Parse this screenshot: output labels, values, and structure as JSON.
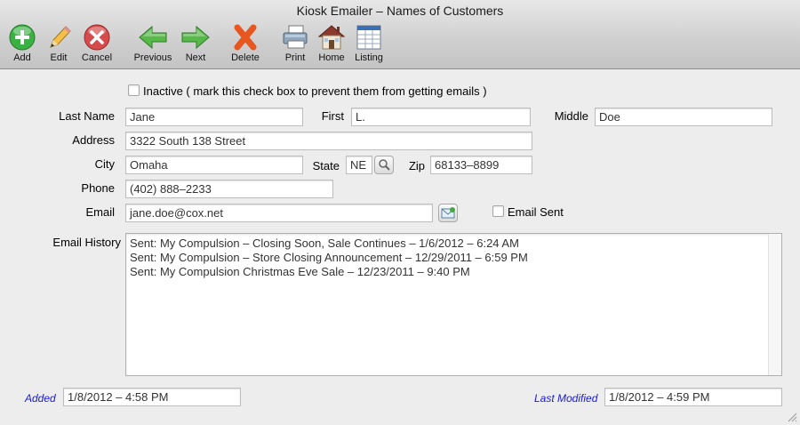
{
  "window": {
    "title": "Kiosk Emailer – Names of Customers"
  },
  "toolbar": {
    "add": "Add",
    "edit": "Edit",
    "cancel": "Cancel",
    "previous": "Previous",
    "next": "Next",
    "delete": "Delete",
    "print": "Print",
    "home": "Home",
    "listing": "Listing"
  },
  "colors": {
    "add_green": "#3bb143",
    "cancel_red": "#d64c4c",
    "arrow_green": "#57b947",
    "delete_orange": "#e8561f",
    "meta_label_blue": "#1a1ad6"
  },
  "form": {
    "inactive_label": "Inactive ( mark this check box to prevent them from getting emails )",
    "inactive_checked": false,
    "last_name_label": "Last Name",
    "last_name_value": "Jane",
    "first_label": "First",
    "first_value": "L.",
    "middle_label": "Middle",
    "middle_value": "Doe",
    "address_label": "Address",
    "address_value": "3322 South 138 Street",
    "city_label": "City",
    "city_value": "Omaha",
    "state_label": "State",
    "state_value": "NE",
    "zip_label": "Zip",
    "zip_value": "68133–8899",
    "phone_label": "Phone",
    "phone_value": "(402) 888–2233",
    "email_label": "Email",
    "email_value": "jane.doe@cox.net",
    "email_sent_label": "Email Sent",
    "email_sent_checked": false,
    "email_history_label": "Email History",
    "email_history": [
      "Sent:  My Compulsion – Closing Soon, Sale Continues – 1/6/2012 – 6:24 AM",
      "Sent:  My Compulsion – Store Closing Announcement – 12/29/2011 – 6:59 PM",
      "Sent:  My Compulsion Christmas Eve Sale – 12/23/2011 – 9:40 PM"
    ],
    "added_label": "Added",
    "added_value": "1/8/2012 – 4:58 PM",
    "last_modified_label": "Last Modified",
    "last_modified_value": "1/8/2012 – 4:59 PM"
  },
  "icons": {
    "add": "plus-circle-icon",
    "edit": "pencil-icon",
    "cancel": "x-circle-icon",
    "previous": "arrow-left-icon",
    "next": "arrow-right-icon",
    "delete": "x-mark-icon",
    "print": "printer-icon",
    "home": "house-icon",
    "listing": "table-icon",
    "state_lookup": "magnifier-icon",
    "email_compose": "envelope-icon"
  }
}
